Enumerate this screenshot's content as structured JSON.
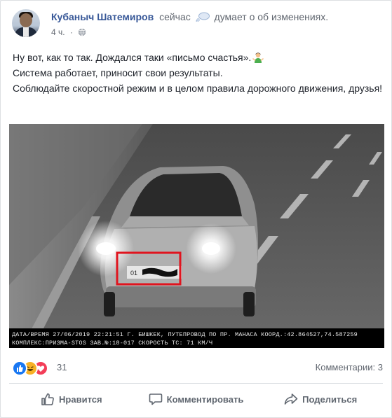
{
  "post": {
    "author": "Кубаныч Шатемиров",
    "time_now": "сейчас",
    "feeling": "думает о об изменениях.",
    "timestamp": "4 ч.",
    "dot": "·",
    "lines": [
      "Ну вот, как то так. Дождался таки «письмо счастья».",
      "Система работает, приносит свои результаты.",
      "Соблюдайте скоростной режим и в целом правила дорожного движения, друзья!"
    ]
  },
  "photo": {
    "caption_line1": "ДАТА/ВРЕМЯ 27/06/2019 22:21:51   Г. БИШКЕК, ПУТЕПРОВОД ПО ПР. МАНАСА    КООРД.:42.864527,74.587259",
    "caption_line2": "КОМПЛЕКС:ПРИЗМА-STOS    ЗАВ.№:18-017   СКОРОСТЬ ТС:  71 КМ/Ч",
    "plate_prefix": "01",
    "highlight_color": "#e0141e"
  },
  "stats": {
    "reaction_count": "31",
    "comments": "Комментарии: 3",
    "reaction_icons": [
      "like-icon",
      "haha-icon",
      "love-icon"
    ]
  },
  "actions": {
    "like": "Нравится",
    "comment": "Комментировать",
    "share": "Поделиться"
  },
  "colors": {
    "link": "#385898",
    "like_blue": "#1877f2",
    "haha_yellow": "#f7b125",
    "love_red": "#f33e58"
  }
}
